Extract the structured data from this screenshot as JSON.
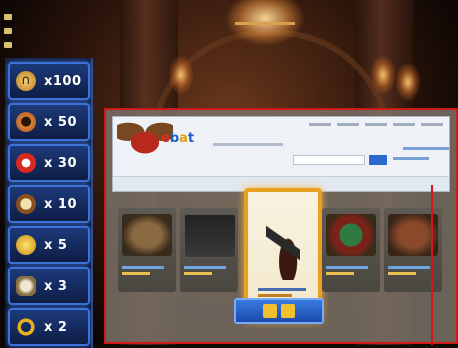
{
  "inventory": {
    "items": [
      {
        "icon": "horseshoe-icon",
        "qty": "x100"
      },
      {
        "icon": "fruit-icon",
        "qty": "x 50"
      },
      {
        "icon": "mushroom-icon",
        "qty": "x 30"
      },
      {
        "icon": "clock-icon",
        "qty": "x 10"
      },
      {
        "icon": "gold-coins-icon",
        "qty": "x  5"
      },
      {
        "icon": "vase-icon",
        "qty": "x  3"
      },
      {
        "icon": "gold-ring-icon",
        "qty": "x  2"
      }
    ]
  },
  "colors": {
    "slot_border": "#3d72d6",
    "shop_border": "#d01818",
    "featured_border": "#e8a020"
  }
}
